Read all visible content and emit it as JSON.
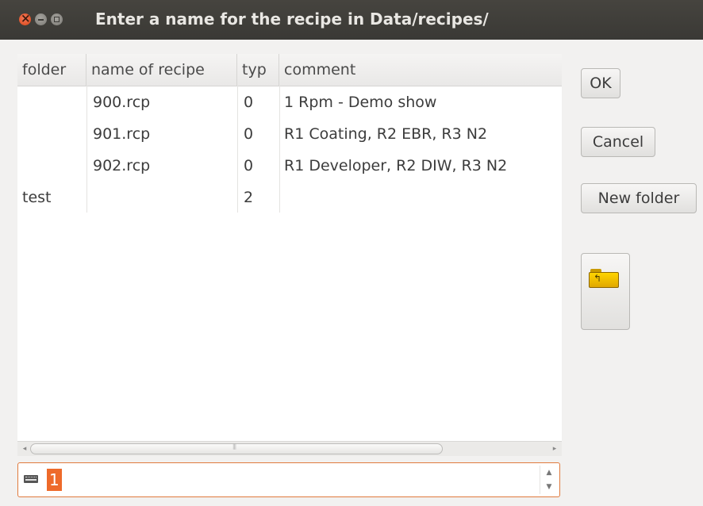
{
  "window": {
    "title": "Enter a name for the recipe in Data/recipes/"
  },
  "table": {
    "columns": [
      "folder",
      "name of recipe",
      "typ",
      "comment"
    ],
    "rows": [
      {
        "folder": "",
        "name": "900.rcp",
        "typ": "0",
        "comment": "1 Rpm - Demo show"
      },
      {
        "folder": "",
        "name": "901.rcp",
        "typ": "0",
        "comment": "R1 Coating, R2 EBR, R3 N2"
      },
      {
        "folder": "",
        "name": "902.rcp",
        "typ": "0",
        "comment": "R1 Developer, R2 DIW, R3 N2"
      },
      {
        "folder": "test",
        "name": "",
        "typ": "2",
        "comment": ""
      }
    ]
  },
  "input": {
    "value": "1",
    "icon": "keyboard-icon"
  },
  "buttons": {
    "ok": "OK",
    "cancel": "Cancel",
    "new_folder": "New folder",
    "folder_up_icon": "folder-up-icon"
  },
  "colors": {
    "accent": "#ee6a2a",
    "titlebar": "#3c3b37",
    "close": "#e3561e"
  }
}
